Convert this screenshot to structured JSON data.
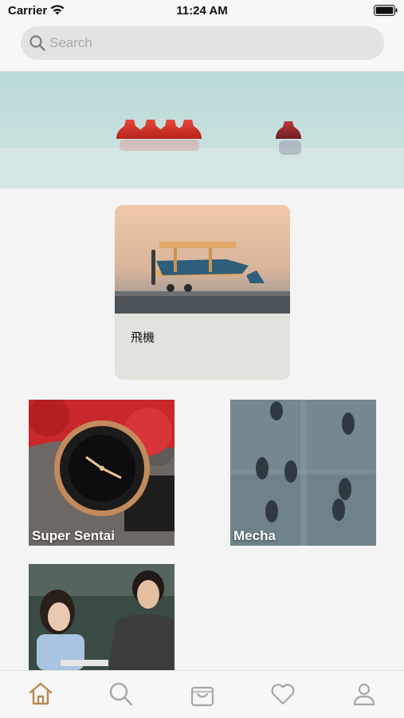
{
  "status_bar": {
    "carrier": "Carrier",
    "time": "11:24 AM"
  },
  "search": {
    "placeholder": "Search"
  },
  "featured": {
    "caption": "飛機"
  },
  "categories": [
    {
      "label": "Super Sentai"
    },
    {
      "label": "Mecha"
    },
    {
      "label": ""
    }
  ],
  "tab_bar": {
    "items": [
      {
        "icon": "home-icon",
        "active": true
      },
      {
        "icon": "search-icon"
      },
      {
        "icon": "shopping-bag-icon"
      },
      {
        "icon": "heart-icon"
      },
      {
        "icon": "profile-icon"
      }
    ],
    "active_color": "#b58a52",
    "inactive_color": "#a7a7a7"
  }
}
